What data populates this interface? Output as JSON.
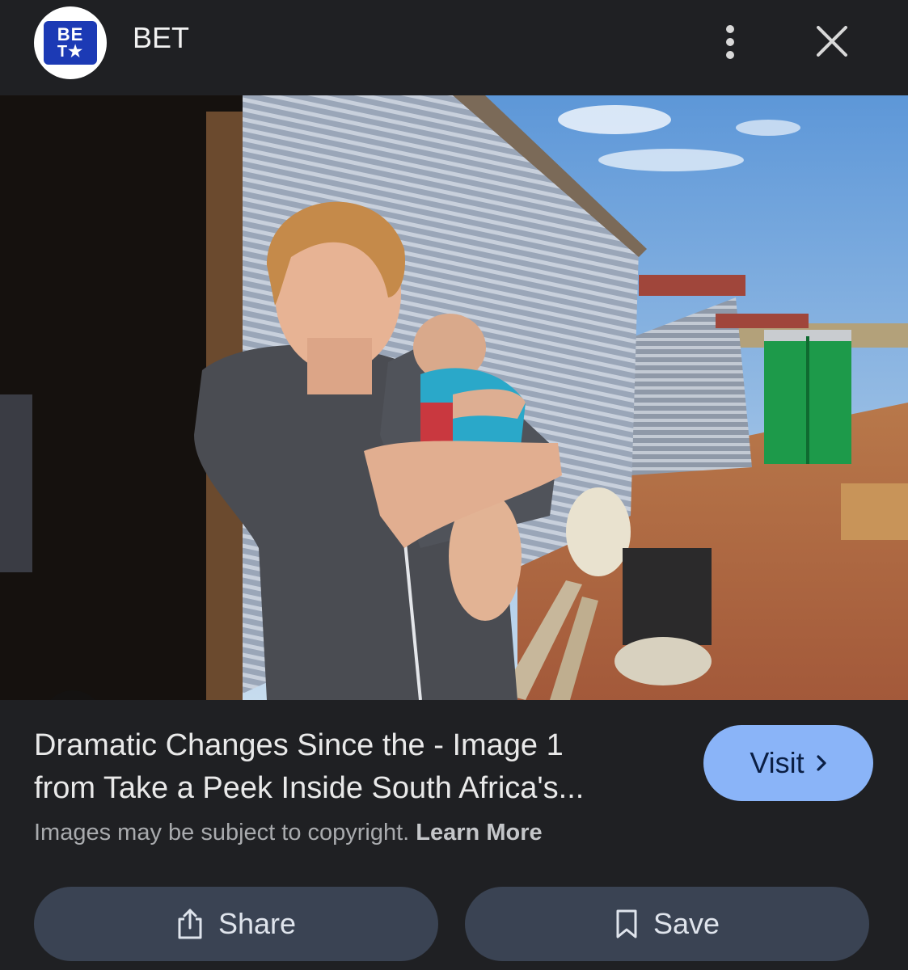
{
  "header": {
    "logo_line1": "BE",
    "logo_line2": "T★",
    "site_name": "BET",
    "more_icon": "more-vert-icon",
    "close_icon": "close-icon"
  },
  "image": {
    "lens_icon": "google-lens-icon"
  },
  "result": {
    "title_line1": "Dramatic Changes Since the - Image 1",
    "title_line2": "from Take a Peek Inside South Africa's...",
    "visit_label": "Visit",
    "copyright_text": "Images may be subject to copyright.",
    "learn_more": "Learn More"
  },
  "actions": {
    "share_label": "Share",
    "save_label": "Save"
  },
  "colors": {
    "background": "#1f2023",
    "visit_button": "#8ab4f8",
    "action_button": "#3a4353",
    "logo_blue": "#1c3ab5"
  }
}
